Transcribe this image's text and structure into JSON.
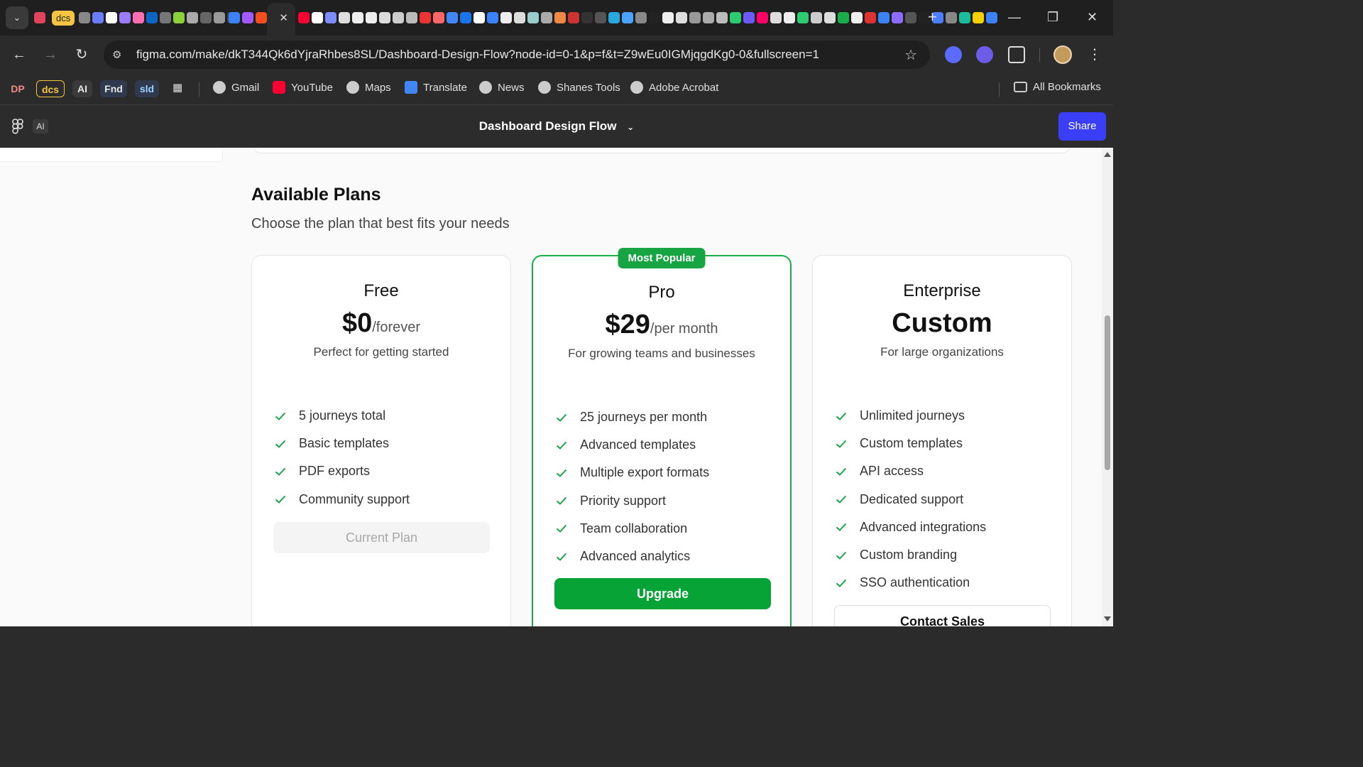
{
  "browser": {
    "pinned_tab_label": "dcs",
    "address_url": "figma.com/make/dkT344Qk6dYjraRhbes8SL/Dashboard-Design-Flow?node-id=0-1&p=f&t=Z9wEu0IGMjqgdKg0-0&fullscreen=1",
    "bookmark_chips": [
      {
        "label": "DP",
        "bg": "#3a3a3a",
        "fg": "#f08a8a"
      },
      {
        "label": "dcs",
        "bg": "#3d3424",
        "fg": "#f5c542"
      },
      {
        "label": "AI",
        "bg": "#3a3a3a",
        "fg": "#e8e8e8"
      },
      {
        "label": "Fnd",
        "bg": "#2f3a4f",
        "fg": "#e8e8e8"
      },
      {
        "label": "sld",
        "bg": "#2f3a4f",
        "fg": "#9fd0ff"
      }
    ],
    "bookmarks": [
      {
        "label": "Gmail",
        "icon": "globe-icon"
      },
      {
        "label": "YouTube",
        "icon": "youtube-icon"
      },
      {
        "label": "Maps",
        "icon": "globe-icon"
      },
      {
        "label": "Translate",
        "icon": "translate-icon"
      },
      {
        "label": "News",
        "icon": "globe-icon"
      },
      {
        "label": "Shanes Tools",
        "icon": "globe-icon"
      },
      {
        "label": "Adobe Acrobat",
        "icon": "globe-icon"
      }
    ],
    "all_bookmarks_label": "All Bookmarks"
  },
  "figma": {
    "ai_label": "AI",
    "file_title": "Dashboard Design Flow",
    "share_label": "Share"
  },
  "plans_section": {
    "title": "Available Plans",
    "subtitle": "Choose the plan that best fits your needs",
    "accent_color": "#07a337",
    "plans": [
      {
        "name": "Free",
        "price": "$0",
        "period": "/forever",
        "description": "Perfect for getting started",
        "features": [
          "5 journeys total",
          "Basic templates",
          "PDF exports",
          "Community support"
        ],
        "button": "Current Plan"
      },
      {
        "name": "Pro",
        "badge": "Most Popular",
        "price": "$29",
        "period": "/per month",
        "description": "For growing teams and businesses",
        "features": [
          "25 journeys per month",
          "Advanced templates",
          "Multiple export formats",
          "Priority support",
          "Team collaboration",
          "Advanced analytics"
        ],
        "button": "Upgrade"
      },
      {
        "name": "Enterprise",
        "price": "Custom",
        "period": "",
        "description": "For large organizations",
        "features": [
          "Unlimited journeys",
          "Custom templates",
          "API access",
          "Dedicated support",
          "Advanced integrations",
          "Custom branding",
          "SSO authentication"
        ],
        "button": "Contact Sales"
      }
    ]
  }
}
